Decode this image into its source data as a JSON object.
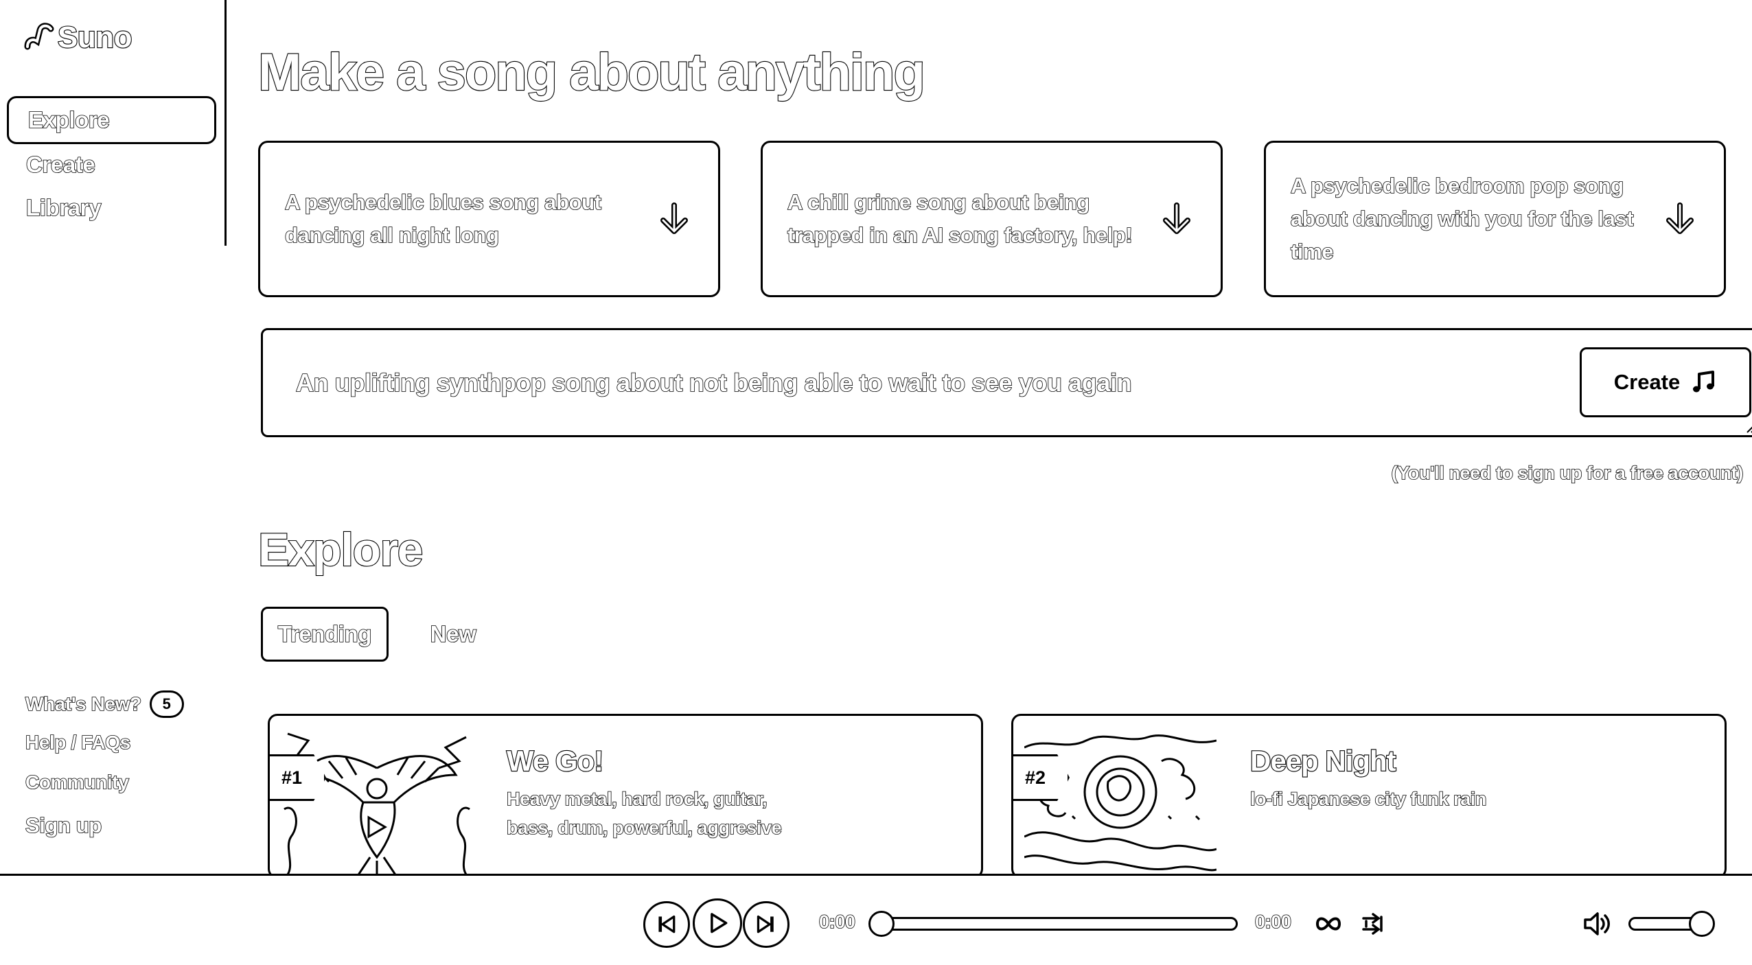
{
  "app": {
    "name": "Suno"
  },
  "sidebar": {
    "nav": [
      {
        "label": "Explore",
        "active": true
      },
      {
        "label": "Create"
      },
      {
        "label": "Library"
      }
    ],
    "footer": {
      "whats_new": "What's New?",
      "whats_new_count": "5",
      "help": "Help / FAQs",
      "community": "Community",
      "sign_up": "Sign up"
    }
  },
  "hero": {
    "title": "Make a song about anything",
    "suggestions": [
      "A psychedelic blues song about dancing all night long",
      "A chill grime song about being trapped in an AI song factory, help!",
      "A psychedelic bedroom pop song about dancing with you for the last time"
    ],
    "prompt_value": "An uplifting synthpop song about not being able to wait to see you again",
    "create_label": "Create",
    "signup_note": "(You'll need to sign up for a free account)"
  },
  "explore": {
    "title": "Explore",
    "tabs": [
      {
        "label": "Trending",
        "active": true
      },
      {
        "label": "New"
      }
    ],
    "songs": [
      {
        "rank": "#1",
        "title": "We Go!",
        "tags": "Heavy metal, hard rock, guitar, bass, drum, powerful, aggresive"
      },
      {
        "rank": "#2",
        "title": "Deep Night",
        "tags": "lo-fi Japanese city funk rain"
      }
    ]
  },
  "player": {
    "current_time": "0:00",
    "total_time": "0:00",
    "progress": 0,
    "volume": 1.0
  },
  "icons": {
    "logo": "suno-logo-icon",
    "suggestion": "arrow-down-icon",
    "create": "music-note-icon",
    "prev": "skip-back-icon",
    "play": "play-icon",
    "next": "skip-forward-icon",
    "loop": "loop-icon",
    "shuffle": "shuffle-icon",
    "volume": "volume-icon"
  }
}
